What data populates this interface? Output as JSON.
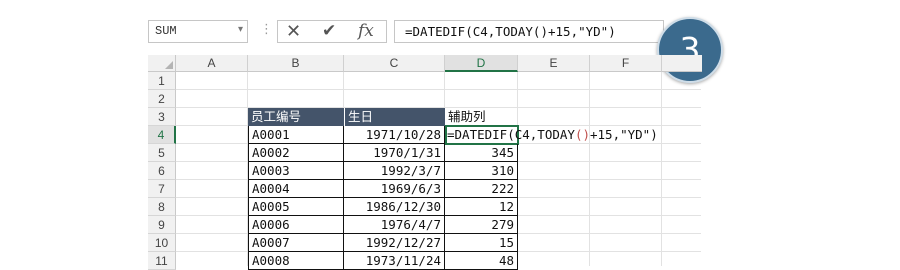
{
  "formula_bar": {
    "name_box": "SUM",
    "name_box_arrow": "▾",
    "separator": "⋮",
    "cancel_glyph": "✕",
    "enter_glyph": "✔",
    "fx_glyph": "fx",
    "formula": "=DATEDIF(C4,TODAY()+15,\"YD\")"
  },
  "step_badge": "3",
  "columns": [
    "A",
    "B",
    "C",
    "D",
    "E",
    "F"
  ],
  "rows": [
    "1",
    "2",
    "3",
    "4",
    "5",
    "6",
    "7",
    "8",
    "9",
    "10",
    "11"
  ],
  "table": {
    "header": {
      "id": "员工编号",
      "birthday": "生日",
      "helper": "辅助列"
    },
    "records": [
      {
        "id": "A0001",
        "birthday": "1971/10/28",
        "helper": ""
      },
      {
        "id": "A0002",
        "birthday": "1970/1/31",
        "helper": "345"
      },
      {
        "id": "A0003",
        "birthday": "1992/3/7",
        "helper": "310"
      },
      {
        "id": "A0004",
        "birthday": "1969/6/3",
        "helper": "222"
      },
      {
        "id": "A0005",
        "birthday": "1986/12/30",
        "helper": "12"
      },
      {
        "id": "A0006",
        "birthday": "1976/4/7",
        "helper": "279"
      },
      {
        "id": "A0007",
        "birthday": "1992/12/27",
        "helper": "15"
      },
      {
        "id": "A0008",
        "birthday": "1973/11/24",
        "helper": "48"
      }
    ]
  },
  "editing_cell": {
    "ref": "D4",
    "formula_before": "=DATEDIF(C4,TODAY",
    "paren": "()",
    "formula_after": "+15,\"YD\")"
  },
  "colors": {
    "header_fill": "#44546a",
    "excel_green": "#217346",
    "badge": "#3b6a8d"
  }
}
